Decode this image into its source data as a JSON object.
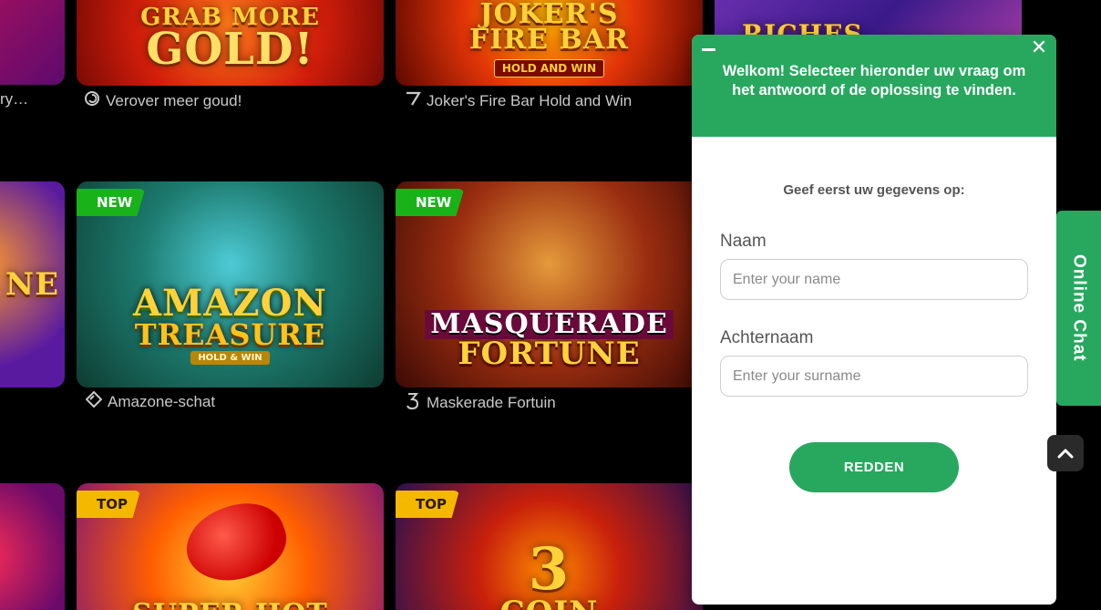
{
  "colors": {
    "accent_green": "#27a85e",
    "badge_new": "#19b319",
    "badge_top": "#f5b800",
    "caption_text": "#c9c9c9",
    "background": "#000000"
  },
  "games": {
    "row1": {
      "left_caption": "ry…",
      "gold": {
        "art_title_1": "GRAB MORE",
        "art_title_2": "GOLD!",
        "caption": "Verover meer goud!",
        "provider_icon": "spiral-provider-icon"
      },
      "joker": {
        "art_title_1": "JOKER'S",
        "art_title_2": "FIRE BAR",
        "art_sub": "HOLD AND WIN",
        "caption": "Joker's Fire Bar Hold and Win",
        "provider_icon": "seven-provider-icon"
      },
      "riches": {
        "art_title_1": "RICHES"
      }
    },
    "row2": {
      "left_art": "NE",
      "amazon": {
        "badge": "NEW",
        "art_title_1": "AMAZON",
        "art_title_2": "TREASURE",
        "art_sub": "HOLD & WIN",
        "caption": "Amazone-schat",
        "provider_icon": "diamond-provider-icon"
      },
      "masquerade": {
        "badge": "NEW",
        "art_title_1": "MASQUERADE",
        "art_title_2": "FORTUNE",
        "caption": "Maskerade Fortuin",
        "provider_icon": "three-provider-icon"
      }
    },
    "row3": {
      "superhot": {
        "badge": "TOP",
        "art_title_1": "SUPER HOT"
      },
      "coin3": {
        "badge": "TOP",
        "art_title_1": "3",
        "art_title_2": "COIN"
      }
    }
  },
  "chat": {
    "welcome": "Welkom! Selecteer hieronder uw vraag om het antwoord of de oplossing te vinden.",
    "intro": "Geef eerst uw gegevens op:",
    "name_label": "Naam",
    "name_placeholder": "Enter your name",
    "surname_label": "Achternaam",
    "surname_placeholder": "Enter your surname",
    "submit_label": "REDDEN",
    "close_glyph": "✕",
    "minimize_icon": "minus-icon"
  },
  "online_chat_tab": {
    "label": "Online Chat"
  },
  "scroll_top": {
    "icon": "chevron-up-icon"
  }
}
